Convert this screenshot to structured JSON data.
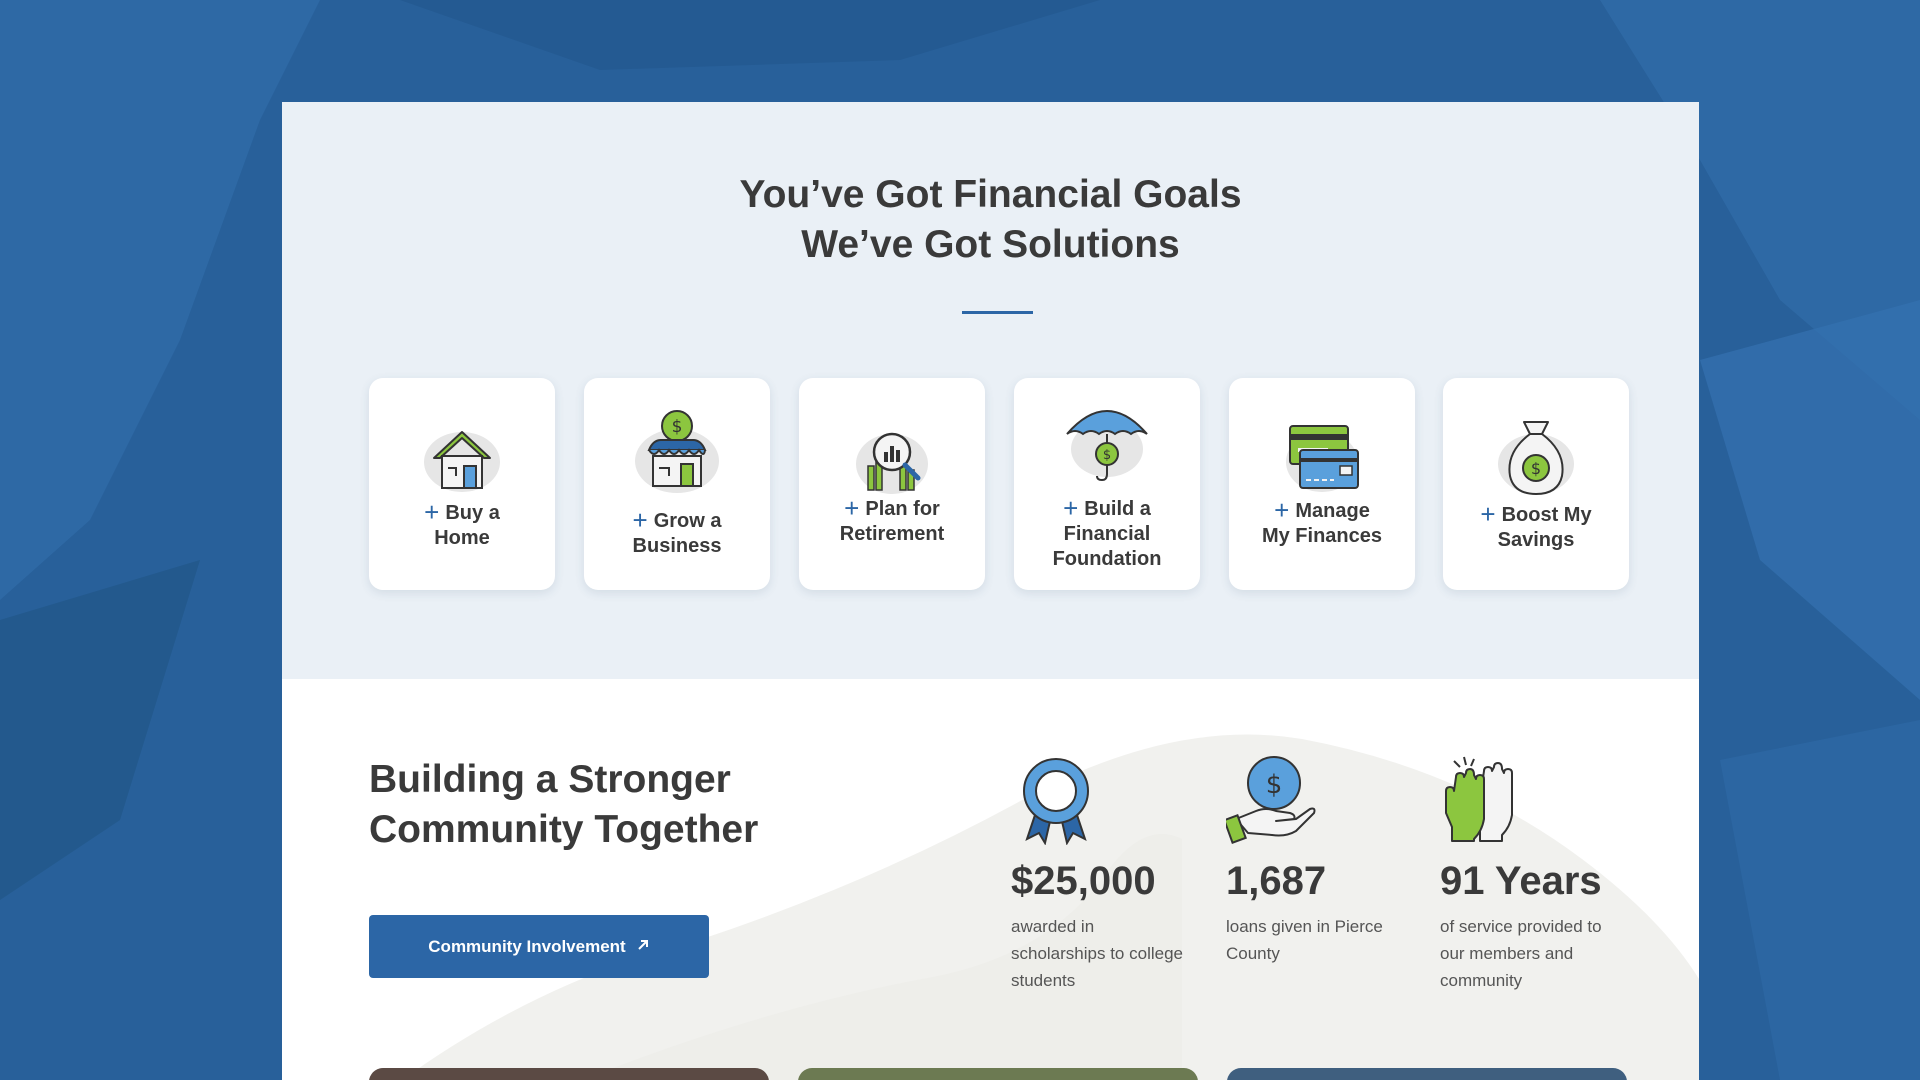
{
  "goals": {
    "title_line1": "You’ve Got Financial Goals",
    "title_line2": "We’ve Got Solutions",
    "cards": [
      {
        "plus": "+",
        "line1": "Buy a",
        "line2": "Home",
        "icon": "house-icon"
      },
      {
        "plus": "+",
        "line1": "Grow a",
        "line2": "Business",
        "icon": "storefront-icon"
      },
      {
        "plus": "+",
        "line1": "Plan for",
        "line2": "Retirement",
        "icon": "magnifier-chart-icon"
      },
      {
        "plus": "+",
        "line1": "Build a",
        "line2": "Financial",
        "line3": "Foundation",
        "icon": "umbrella-icon"
      },
      {
        "plus": "+",
        "line1": "Manage",
        "line2": "My Finances",
        "icon": "credit-cards-icon"
      },
      {
        "plus": "+",
        "line1": "Boost My",
        "line2": "Savings",
        "icon": "money-bag-icon"
      }
    ]
  },
  "community": {
    "title_line1": "Building a Stronger",
    "title_line2": "Community Together",
    "cta_label": "Community Involvement",
    "cta_icon": "external-arrow-icon",
    "stats": [
      {
        "value": "$25,000",
        "desc_line1": "awarded in",
        "desc_line2": "scholarships to college",
        "desc_line3": "students",
        "icon": "award-ribbon-icon"
      },
      {
        "value": "1,687",
        "desc_line1": "loans given in Pierce",
        "desc_line2": "County",
        "desc_line3": "",
        "icon": "hand-coin-icon"
      },
      {
        "value": "91 Years",
        "desc_line1": "of service provided to",
        "desc_line2": "our members and",
        "desc_line3": "community",
        "icon": "high-five-icon"
      }
    ]
  },
  "colors": {
    "background": "#28609a",
    "accent_blue": "#2c66a6",
    "accent_green": "#8cc63f",
    "text_dark": "#3a3a3a",
    "goals_bg": "#eaf0f6"
  }
}
